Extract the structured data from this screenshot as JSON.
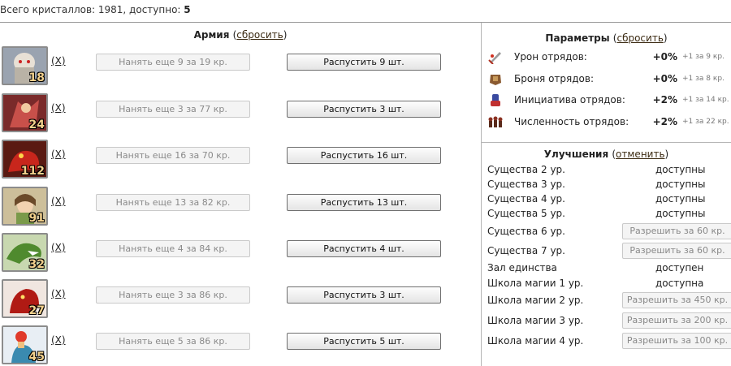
{
  "header": {
    "crystals_label": "Всего кристаллов: 1981, доступно:",
    "crystals_available": "5"
  },
  "army": {
    "title": "Армия",
    "reset_open": "(",
    "reset_label": "сбросить",
    "reset_close": ")",
    "x_label": "(X)",
    "units": [
      {
        "count": "18",
        "hire": "Нанять еще 9 за 19 кр.",
        "dismiss": "Распустить 9 шт."
      },
      {
        "count": "24",
        "hire": "Нанять еще 3 за 77 кр.",
        "dismiss": "Распустить 3 шт."
      },
      {
        "count": "112",
        "hire": "Нанять еще 16 за 70 кр.",
        "dismiss": "Распустить 16 шт."
      },
      {
        "count": "91",
        "hire": "Нанять еще 13 за 82 кр.",
        "dismiss": "Распустить 13 шт."
      },
      {
        "count": "32",
        "hire": "Нанять еще 4 за 84 кр.",
        "dismiss": "Распустить 4 шт."
      },
      {
        "count": "27",
        "hire": "Нанять еще 3 за 86 кр.",
        "dismiss": "Распустить 3 шт."
      },
      {
        "count": "45",
        "hire": "Нанять еще 5 за 86 кр.",
        "dismiss": "Распустить 5 шт."
      }
    ]
  },
  "params": {
    "title": "Параметры",
    "reset_open": "(",
    "reset_label": "сбросить",
    "reset_close": ")",
    "items": [
      {
        "icon": "sword-icon",
        "label": "Урон отрядов:",
        "value": "+0%",
        "cost": "+1 за 9 кр."
      },
      {
        "icon": "armor-icon",
        "label": "Броня отрядов:",
        "value": "+0%",
        "cost": "+1 за 8 кр."
      },
      {
        "icon": "initiative-icon",
        "label": "Инициатива отрядов:",
        "value": "+2%",
        "cost": "+1 за 14 кр."
      },
      {
        "icon": "troops-icon",
        "label": "Численность отрядов:",
        "value": "+2%",
        "cost": "+1 за 22 кр."
      }
    ]
  },
  "upgrades": {
    "title": "Улучшения",
    "cancel_open": "(",
    "cancel_label": "отменить",
    "cancel_close": ")",
    "items": [
      {
        "label": "Существа 2 ур.",
        "status": "доступны"
      },
      {
        "label": "Существа 3 ур.",
        "status": "доступны"
      },
      {
        "label": "Существа 4 ур.",
        "status": "доступны"
      },
      {
        "label": "Существа 5 ур.",
        "status": "доступны"
      },
      {
        "label": "Существа 6 ур.",
        "button": "Разрешить за 60 кр."
      },
      {
        "label": "Существа 7 ур.",
        "button": "Разрешить за 60 кр."
      },
      {
        "label": "Зал единства",
        "status": "доступен"
      },
      {
        "label": "Школа магии 1 ур.",
        "status": "доступна"
      },
      {
        "label": "Школа магии 2 ур.",
        "button": "Разрешить за 450 кр."
      },
      {
        "label": "Школа магии 3 ур.",
        "button": "Разрешить за 200 кр."
      },
      {
        "label": "Школа магии 4 ур.",
        "button": "Разрешить за 100 кр."
      }
    ]
  }
}
